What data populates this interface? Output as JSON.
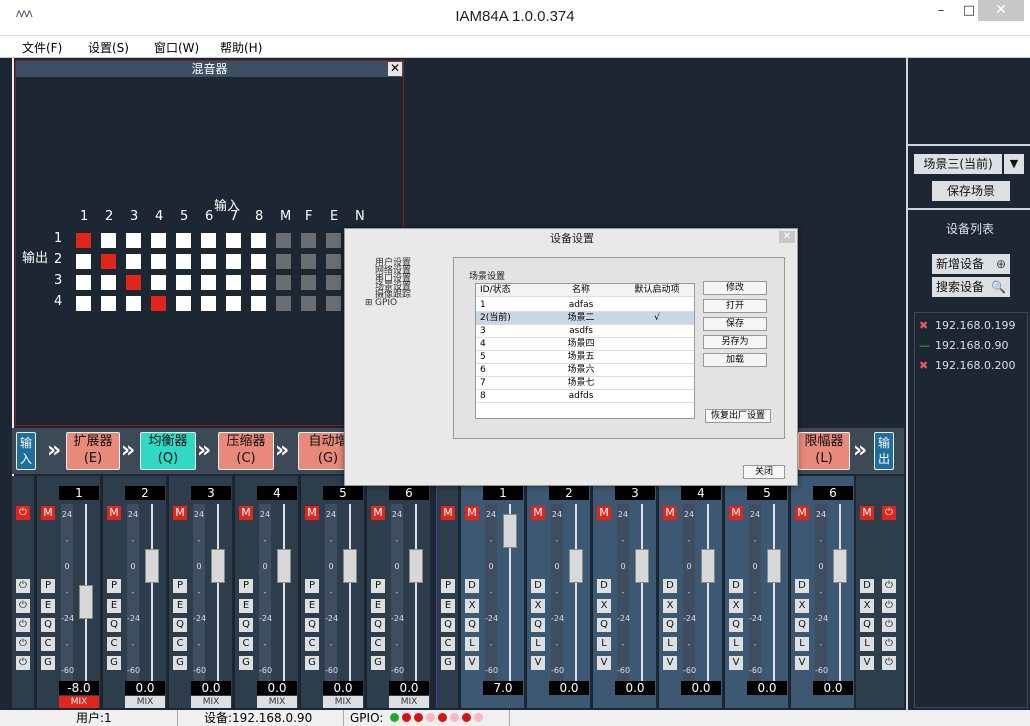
{
  "window": {
    "title": "IAM84A 1.0.0.374",
    "logo": "ΛΛΛ",
    "minimize": "–",
    "maximize": "□",
    "close": "✕"
  },
  "menu": [
    "文件(F)",
    "设置(S)",
    "窗口(W)",
    "帮助(H)"
  ],
  "mixer": {
    "title": "混音器",
    "close": "✕",
    "input_label": "输入",
    "output_label": "输出",
    "columns": [
      "1",
      "2",
      "3",
      "4",
      "5",
      "6",
      "7",
      "8",
      "M",
      "F",
      "E",
      "N"
    ],
    "rows": [
      "1",
      "2",
      "3",
      "4"
    ],
    "active": [
      [
        0,
        0
      ],
      [
        1,
        1
      ],
      [
        2,
        2
      ],
      [
        3,
        3
      ]
    ],
    "disabled_from_col": 8
  },
  "right_panel": {
    "scene_current": "场景三(当前)",
    "scene_arrow": "▼",
    "save_scene": "保存场景",
    "device_list_label": "设备列表",
    "add_device": "新增设备",
    "add_icon": "⊕",
    "search_device": "搜索设备",
    "search_icon": "🔍",
    "devices": [
      {
        "ip": "192.168.0.199",
        "mark": "✖",
        "status": "disconnected"
      },
      {
        "ip": "192.168.0.90",
        "mark": "—",
        "status": "connected"
      },
      {
        "ip": "192.168.0.200",
        "mark": "✖",
        "status": "disconnected"
      }
    ]
  },
  "chain": {
    "blocks": [
      {
        "label": "输\n入",
        "short": "输入",
        "color": "#1e6fa0"
      },
      {
        "label": "扩展器",
        "sub": "(E)",
        "color": "#e8897a"
      },
      {
        "label": "均衡器",
        "sub": "(Q)",
        "color": "#2fd9c4"
      },
      {
        "label": "压缩器",
        "sub": "(C)",
        "color": "#e8897a"
      },
      {
        "label": "自动增",
        "sub": "(G)",
        "color": "#e8897a"
      },
      {
        "label": "限幅器",
        "sub": "(L)",
        "color": "#e8897a"
      },
      {
        "label": "输出",
        "short": "输出",
        "color": "#1e6fa0"
      }
    ],
    "arrow": "»"
  },
  "strips": {
    "power": "⏻",
    "mute": "M",
    "scale": [
      "24",
      "-",
      "0",
      "-",
      "-24",
      "-",
      "-60"
    ],
    "inputs": [
      {
        "num": "1",
        "value": "-8.0",
        "mix": "MIX",
        "level": 0.55
      },
      {
        "num": "2",
        "value": "0.0",
        "mix": "MIX",
        "level": 0.35
      },
      {
        "num": "3",
        "value": "0.0",
        "mix": "MIX",
        "level": 0.35
      },
      {
        "num": "4",
        "value": "0.0",
        "mix": "MIX",
        "level": 0.35
      },
      {
        "num": "5",
        "value": "0.0",
        "mix": "MIX",
        "level": 0.35
      },
      {
        "num": "6",
        "value": "0.0",
        "mix": "MIX",
        "level": 0.35
      }
    ],
    "input_fx": [
      "P",
      "E",
      "Q",
      "C",
      "G"
    ],
    "outputs": [
      {
        "num": "1",
        "value": "7.0",
        "level": 0.15
      },
      {
        "num": "2",
        "value": "0.0",
        "level": 0.35
      },
      {
        "num": "3",
        "value": "0.0",
        "level": 0.35
      },
      {
        "num": "4",
        "value": "0.0",
        "level": 0.35
      },
      {
        "num": "5",
        "value": "0.0",
        "level": 0.35
      },
      {
        "num": "6",
        "value": "0.0",
        "level": 0.35
      }
    ],
    "output_fx": [
      "D",
      "X",
      "Q",
      "L",
      "V"
    ]
  },
  "statusbar": {
    "user": "用户:1",
    "device": "设备:192.168.0.90",
    "gpio_label": "GPIO:",
    "gpio": [
      "#22aa22",
      "#dd1111",
      "#dd1111",
      "#ffb6c1",
      "#dd1111",
      "#ffb6c1",
      "#dd1111",
      "#ffb6c1"
    ]
  },
  "dialog": {
    "title": "设备设置",
    "close": "✕",
    "tree": [
      "用户设置",
      "网络设置",
      "串口设置",
      "场景设置",
      "摄像跟踪",
      "GPIO"
    ],
    "group_label": "场景设置",
    "columns": [
      "ID/状态",
      "名称",
      "默认启动项"
    ],
    "rows": [
      {
        "id": "1",
        "name": "adfas",
        "default": ""
      },
      {
        "id": "2(当前)",
        "name": "场景二",
        "default": "√"
      },
      {
        "id": "3",
        "name": "asdfs",
        "default": ""
      },
      {
        "id": "4",
        "name": "场景四",
        "default": ""
      },
      {
        "id": "5",
        "name": "场景五",
        "default": ""
      },
      {
        "id": "6",
        "name": "场景六",
        "default": ""
      },
      {
        "id": "7",
        "name": "场景七",
        "default": ""
      },
      {
        "id": "8",
        "name": "adfds",
        "default": ""
      }
    ],
    "buttons": [
      "修改",
      "打开",
      "保存",
      "另存为",
      "加载"
    ],
    "factory_reset": "恢复出厂设置",
    "close_button": "关闭"
  }
}
